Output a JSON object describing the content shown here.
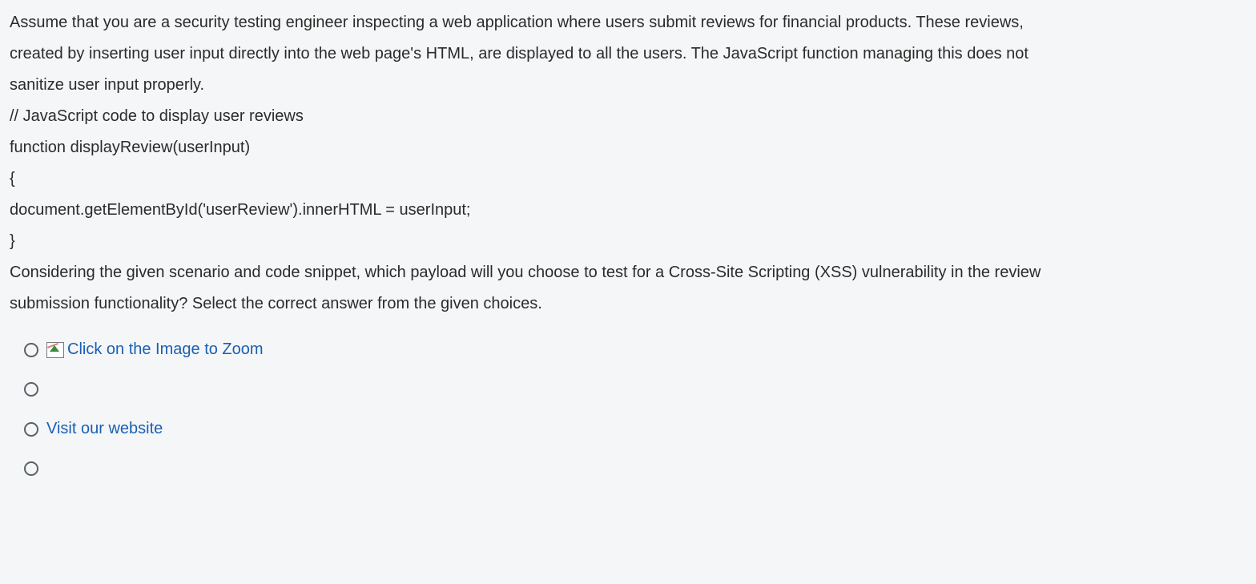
{
  "question": {
    "line1": "Assume that you are a security testing engineer inspecting a web application where users submit reviews for financial products. These reviews,",
    "line2": "created by inserting user input directly into the web page's HTML, are displayed to all the users. The JavaScript function managing this does not",
    "line3": "sanitize user input properly.",
    "code1": "// JavaScript code to display user reviews",
    "code2": "function displayReview(userInput)",
    "code3": "{",
    "code4": "document.getElementById('userReview').innerHTML = userInput;",
    "code5": "}",
    "line4": "Considering the given scenario and code snippet, which payload will you choose to test for a Cross-Site Scripting (XSS) vulnerability in the review",
    "line5": "submission functionality? Select the correct answer from the given choices."
  },
  "options": {
    "opt1": "Click on the Image to Zoom",
    "opt2": "",
    "opt3": "Visit our website",
    "opt4": ""
  }
}
